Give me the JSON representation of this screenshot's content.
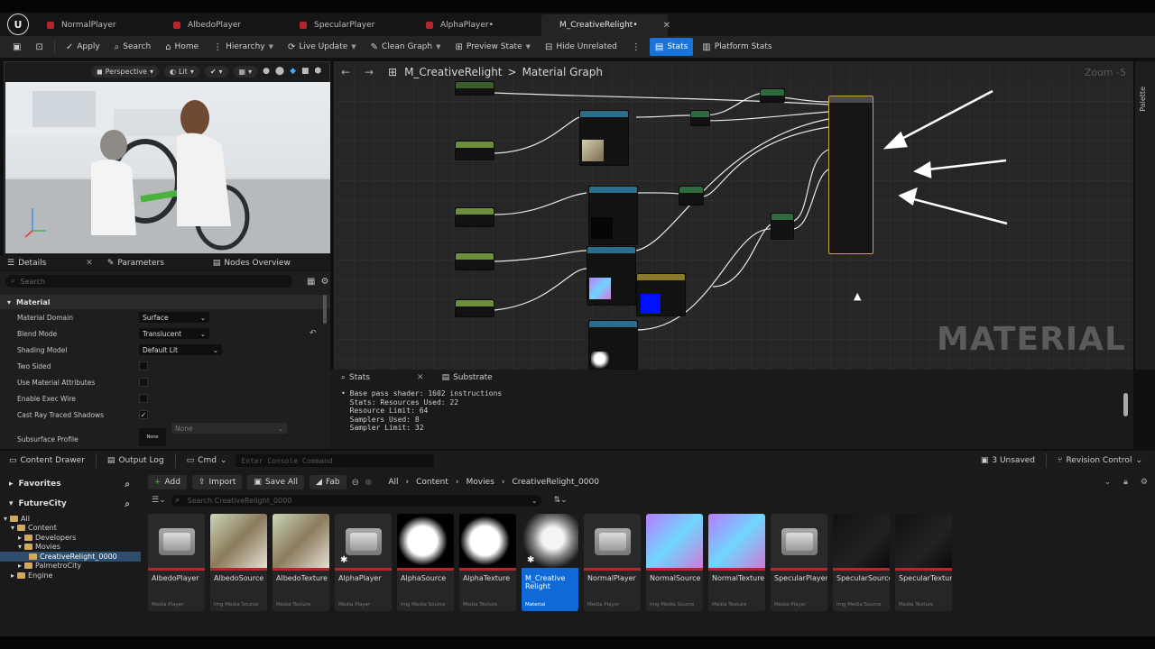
{
  "tabs": [
    {
      "label": "NormalPlayer",
      "active": false
    },
    {
      "label": "AlbedoPlayer",
      "active": false
    },
    {
      "label": "SpecularPlayer",
      "active": false
    },
    {
      "label": "AlphaPlayer•",
      "active": false
    },
    {
      "label": "M_CreativeRelight•",
      "active": true
    }
  ],
  "toolbar": {
    "apply": "Apply",
    "search": "Search",
    "home": "Home",
    "hierarchy": "Hierarchy",
    "live_update": "Live Update",
    "clean_graph": "Clean Graph",
    "preview_state": "Preview State",
    "hide_unrelated": "Hide Unrelated",
    "stats": "Stats",
    "platform_stats": "Platform Stats"
  },
  "viewport": {
    "perspective": "Perspective",
    "lit": "Lit"
  },
  "details": {
    "tabs": [
      "Details",
      "Parameters",
      "Nodes Overview"
    ],
    "search_placeholder": "Search",
    "section": "Material",
    "props": [
      {
        "label": "Material Domain",
        "value": "Surface"
      },
      {
        "label": "Blend Mode",
        "value": "Translucent"
      },
      {
        "label": "Shading Model",
        "value": "Default Lit"
      },
      {
        "label": "Two Sided",
        "checked": false
      },
      {
        "label": "Use Material Attributes",
        "checked": false
      },
      {
        "label": "Enable Exec Wire",
        "checked": false
      },
      {
        "label": "Cast Ray Traced Shadows",
        "checked": true
      },
      {
        "label": "Subsurface Profile",
        "value": "None",
        "value2": "None"
      }
    ]
  },
  "graph": {
    "breadcrumb_root": "M_CreativeRelight",
    "breadcrumb_sep": ">",
    "breadcrumb_leaf": "Material Graph",
    "zoom": "Zoom -5",
    "watermark": "MATERIAL",
    "palette": "Palette"
  },
  "stats": {
    "tabs": [
      "Stats",
      "Substrate"
    ],
    "lines": [
      "• Base pass shader: 1602 instructions",
      "  Stats: Resources Used: 22",
      "  Resource Limit: 64",
      "  Samplers Used: 8",
      "  Sampler Limit: 32"
    ]
  },
  "bottombar": {
    "content_drawer": "Content Drawer",
    "output_log": "Output Log",
    "cmd": "Cmd",
    "console_placeholder": "Enter Console Command",
    "unsaved": "3 Unsaved",
    "revision_control": "Revision Control"
  },
  "content_browser": {
    "favorites": "Favorites",
    "project": "FutureCity",
    "tree": [
      "All",
      "Content",
      "Developers",
      "Movies",
      "CreativeRelight_0000",
      "PalmetroCity",
      "Engine"
    ],
    "add": "Add",
    "import": "Import",
    "save_all": "Save All",
    "fab": "Fab",
    "path": [
      "All",
      "Content",
      "Movies",
      "CreativeRelight_0000"
    ],
    "search_placeholder": "Search CreativeRelight_0000",
    "assets": [
      {
        "name": "AlbedoPlayer",
        "type": "Media Player",
        "kind": "tv",
        "bar": "#b4282d"
      },
      {
        "name": "AlbedoSource",
        "type": "Img Media Source",
        "kind": "photo",
        "bar": "#b4282d"
      },
      {
        "name": "AlbedoTexture",
        "type": "Media Texture",
        "kind": "photo",
        "bar": "#b4282d"
      },
      {
        "name": "AlphaPlayer",
        "type": "Media Player",
        "kind": "tv",
        "bar": "#b4282d",
        "star": true
      },
      {
        "name": "AlphaSource",
        "type": "Img Media Source",
        "kind": "alpha",
        "bar": "#b4282d"
      },
      {
        "name": "AlphaTexture",
        "type": "Media Texture",
        "kind": "alpha",
        "bar": "#b4282d"
      },
      {
        "name": "M_Creative Relight",
        "type": "Material",
        "kind": "material",
        "bar": "#0f6ad8",
        "selected": true,
        "star": true
      },
      {
        "name": "NormalPlayer",
        "type": "Media Player",
        "kind": "tv",
        "bar": "#b4282d"
      },
      {
        "name": "NormalSource",
        "type": "Img Media Source",
        "kind": "normal",
        "bar": "#b4282d"
      },
      {
        "name": "NormalTexture",
        "type": "Media Texture",
        "kind": "normal",
        "bar": "#b4282d"
      },
      {
        "name": "SpecularPlayer",
        "type": "Media Player",
        "kind": "tv",
        "bar": "#b4282d"
      },
      {
        "name": "SpecularSource",
        "type": "Img Media Source",
        "kind": "dark",
        "bar": "#b4282d"
      },
      {
        "name": "SpecularTexture",
        "type": "Media Texture",
        "kind": "dark",
        "bar": "#b4282d"
      }
    ]
  },
  "colors": {
    "accent": "#1a73d8",
    "tab_dirty": "#b4282d",
    "tab_active_dot": "#44b54c",
    "folder": "#d3a85a"
  }
}
